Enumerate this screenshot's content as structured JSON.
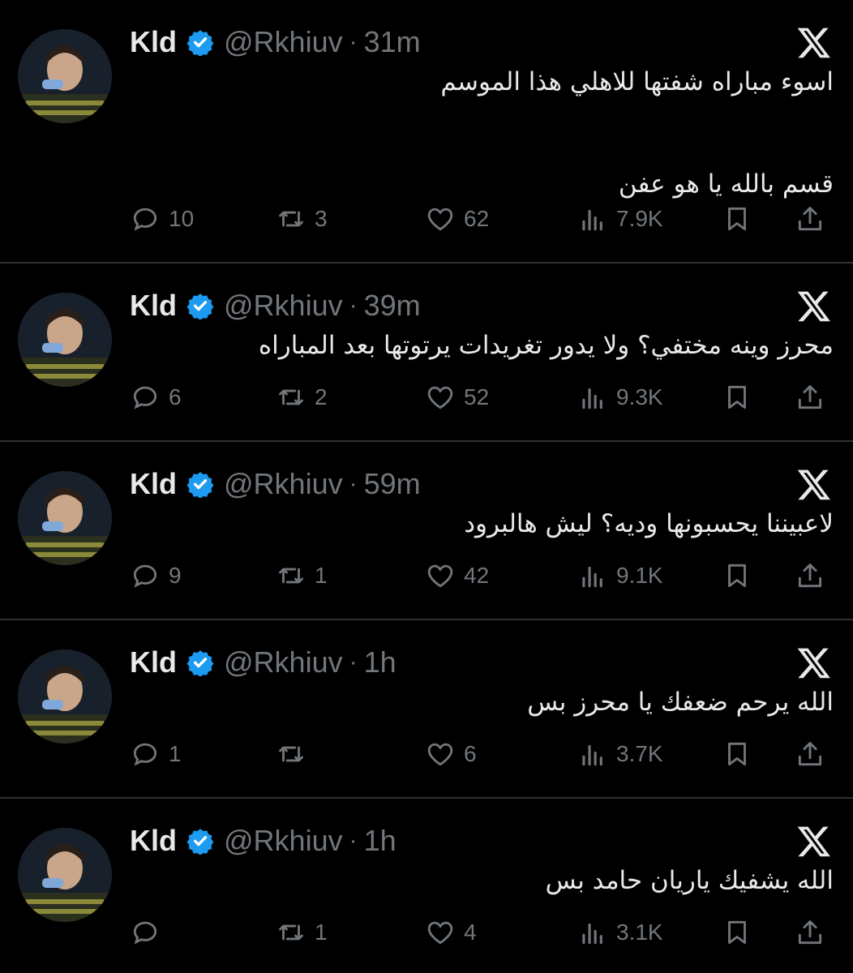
{
  "colors": {
    "background": "#000000",
    "text": "#e7e9ea",
    "muted": "#71767b",
    "verified": "#1d9bf0",
    "divider": "#2f3336"
  },
  "icons": {
    "verified": "verified-badge-icon",
    "logo": "x-logo-icon",
    "reply": "reply-icon",
    "retweet": "retweet-icon",
    "like": "heart-icon",
    "views": "views-icon",
    "bookmark": "bookmark-icon",
    "share": "share-icon"
  },
  "tweets": [
    {
      "name": "Kld",
      "handle": "@Rkhiuv",
      "time": "31m",
      "lines": [
        "اسوء مباراه شفتها للاهلي هذا الموسم",
        "",
        "قسم بالله يا هو عفن"
      ],
      "replies": "10",
      "retweets": "3",
      "likes": "62",
      "views": "7.9K"
    },
    {
      "name": "Kld",
      "handle": "@Rkhiuv",
      "time": "39m",
      "lines": [
        "محرز وينه مختفي؟ ولا يدور تغريدات يرتوتها بعد المباراه"
      ],
      "replies": "6",
      "retweets": "2",
      "likes": "52",
      "views": "9.3K"
    },
    {
      "name": "Kld",
      "handle": "@Rkhiuv",
      "time": "59m",
      "lines": [
        "لاعبيننا يحسبونها وديه؟ ليش هالبرود"
      ],
      "replies": "9",
      "retweets": "1",
      "likes": "42",
      "views": "9.1K"
    },
    {
      "name": "Kld",
      "handle": "@Rkhiuv",
      "time": "1h",
      "lines": [
        "الله يرحم ضعفك يا محرز بس"
      ],
      "replies": "1",
      "retweets": "",
      "likes": "6",
      "views": "3.7K"
    },
    {
      "name": "Kld",
      "handle": "@Rkhiuv",
      "time": "1h",
      "lines": [
        "الله يشفيك ياريان حامد بس"
      ],
      "replies": "",
      "retweets": "1",
      "likes": "4",
      "views": "3.1K"
    }
  ]
}
